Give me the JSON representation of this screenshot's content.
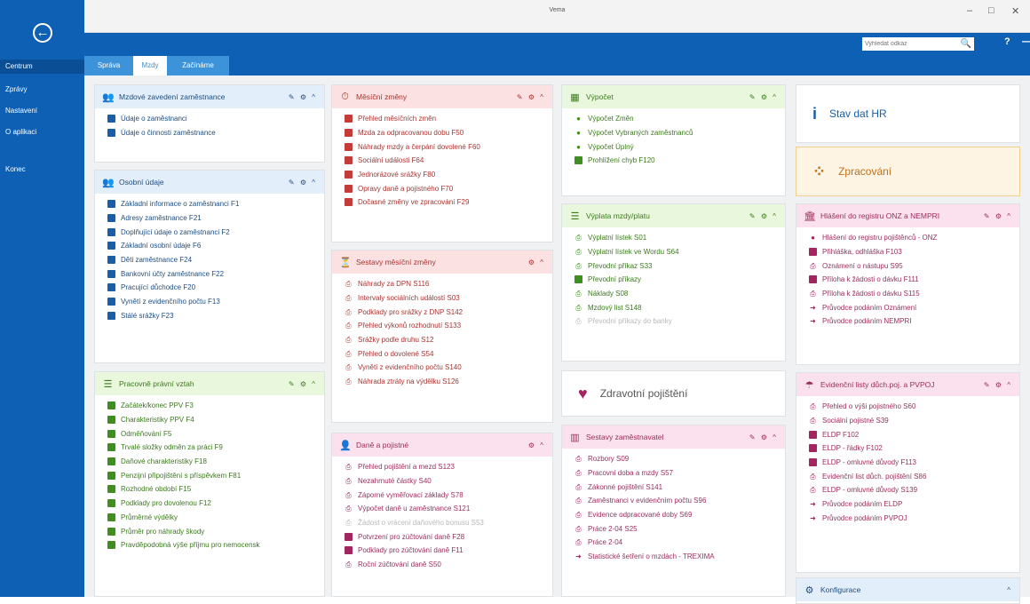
{
  "window": {
    "title": "Vema",
    "minimize": "–",
    "maximize": "□",
    "close": "✕"
  },
  "sidebar": {
    "back_icon": "←",
    "items": [
      {
        "label": "Centrum",
        "active": true
      },
      {
        "label": "Zprávy"
      },
      {
        "label": "Nastavení"
      },
      {
        "label": "O aplikaci"
      },
      {
        "label": "Konec"
      }
    ]
  },
  "topbar": {
    "search_placeholder": "Vyhledat odkaz",
    "search_icon": "🔍",
    "help": "?",
    "dash": "—"
  },
  "tabs": [
    {
      "label": "Správa"
    },
    {
      "label": "Mzdy",
      "active": true
    },
    {
      "label": "Začínáme"
    }
  ],
  "cards": {
    "mzdove": {
      "icon": "👥",
      "title": "Mzdové zavedení zaměstnance",
      "controls": "✎ ⚙ ^",
      "items": [
        "Údaje o zaměstnanci",
        "Údaje o činnosti zaměstnance"
      ]
    },
    "osobni": {
      "icon": "👥",
      "title": "Osobní údaje",
      "controls": "✎ ⚙ ^",
      "items": [
        "Základní informace o zaměstnanci F1",
        "Adresy zaměstnance F21",
        "Doplňující údaje o zaměstnanci F2",
        "Základní osobní údaje F6",
        "Děti zaměstnance F24",
        "Bankovní účty zaměstnance F22",
        "Pracující důchodce F20",
        "Vynětí z evidenčního počtu F13",
        "Stálé srážky F23"
      ]
    },
    "pracovne": {
      "icon": "☰",
      "title": "Pracovně právní vztah",
      "controls": "✎ ⚙ ^",
      "items": [
        "Začátek/konec PPV F3",
        "Charakteristiky PPV F4",
        "Odměňování F5",
        "Trvalé složky odměn za práci F9",
        "Daňové charakteristiky F18",
        "Penzijní připojištění s příspěvkem F81",
        "Rozhodné období F15",
        "Podklady pro dovolenou F12",
        "Průměrné výdělky",
        "Průměr pro náhrady škody",
        "Pravděpodobná výše příjmu pro nemocensk"
      ]
    },
    "mesicni": {
      "icon": "⏱",
      "title": "Měsíční změny",
      "controls": "✎ ⚙ ^",
      "items": [
        "Přehled měsíčních změn",
        "Mzda za odpracovanou dobu F50",
        "Náhrady mzdy a čerpání dovolené F60",
        "Sociální události F64",
        "Jednorázové srážky F80",
        "Opravy daně a pojistného F70",
        "Dočasné změny ve zpracování F29"
      ]
    },
    "sestavy_mesicni": {
      "icon": "⏳",
      "title": "Sestavy měsíční změny",
      "controls": "⚙ ^",
      "items": [
        "Náhrady za DPN S116",
        "Intervaly sociálních událostí S03",
        "Podklady pro srážky z DNP S142",
        "Přehled výkonů rozhodnutí S133",
        "Srážky podle druhu S12",
        "Přehled o dovolené S54",
        "Vynětí z evidenčního počtu S140",
        "Náhrada ztráty na výdělku S126"
      ]
    },
    "dane": {
      "icon": "👤",
      "title": "Daně a pojistné",
      "controls": "⚙ ^",
      "items": [
        {
          "label": "Přehled pojištění a mezd S123",
          "ic": "pr"
        },
        {
          "label": "Nezahrnuté částky S40",
          "ic": "pr"
        },
        {
          "label": "Záporné vyměřovací základy S78",
          "ic": "pr"
        },
        {
          "label": "Výpočet daně u zaměstnance S121",
          "ic": "pr"
        },
        {
          "label": "Žádost o vrácení daňového bonusu S53",
          "ic": "pr",
          "dis": true
        },
        {
          "label": "Potvrzení pro zúčtování daně F28",
          "ic": "sq"
        },
        {
          "label": "Podklady pro zúčtování daně F11",
          "ic": "sq"
        },
        {
          "label": "Roční zúčtování daně S50",
          "ic": "pr"
        }
      ]
    },
    "vypocet": {
      "icon": "▦",
      "title": "Výpočet",
      "controls": "✎ ⚙ ^",
      "items": [
        {
          "label": "Výpočet Změn",
          "ic": "dot"
        },
        {
          "label": "Výpočet Vybraných zaměstnanců",
          "ic": "dot"
        },
        {
          "label": "Výpočet Úplný",
          "ic": "dot"
        },
        {
          "label": "Prohlížení chyb F120",
          "ic": "sq"
        }
      ]
    },
    "vyplata": {
      "icon": "☰",
      "title": "Výplata mzdy/platu",
      "controls": "✎ ⚙ ^",
      "items": [
        {
          "label": "Výplatní lístek S01",
          "ic": "pr"
        },
        {
          "label": "Výplatní lístek ve Wordu S64",
          "ic": "pr"
        },
        {
          "label": "Převodní příkaz S33",
          "ic": "pr"
        },
        {
          "label": "Převodní příkazy",
          "ic": "sq"
        },
        {
          "label": "Náklady S08",
          "ic": "pr"
        },
        {
          "label": "Mzdový list S148",
          "ic": "pr"
        },
        {
          "label": "Převodní příkazy do banky",
          "ic": "pr",
          "dis": true
        }
      ]
    },
    "zdravotni": {
      "icon": "♥",
      "title": "Zdravotní pojištění"
    },
    "sestavy_zam": {
      "icon": "▥",
      "title": "Sestavy zaměstnavatel",
      "controls": "✎ ⚙ ^",
      "items": [
        {
          "label": "Rozbory S09",
          "ic": "pr"
        },
        {
          "label": "Pracovní doba a mzdy S57",
          "ic": "pr"
        },
        {
          "label": "Zákonné pojištění S141",
          "ic": "pr"
        },
        {
          "label": "Zaměstnanci v evidenčním počtu S96",
          "ic": "pr"
        },
        {
          "label": "Evidence odpracované doby S69",
          "ic": "pr"
        },
        {
          "label": "Práce 2-04 S25",
          "ic": "pr"
        },
        {
          "label": "Práce 2-04",
          "ic": "pr"
        },
        {
          "label": "Statistické šetření o mzdách - TREXIMA",
          "ic": "ar"
        }
      ]
    },
    "stav": {
      "icon": "i",
      "title": "Stav dat HR"
    },
    "zpracovani": {
      "icon": "⁘",
      "title": "Zpracování"
    },
    "hlaseni": {
      "icon": "🏛",
      "title": "Hlášení do registru ONZ a NEMPRI",
      "controls": "✎ ⚙ ^",
      "items": [
        {
          "label": "Hlášení do registru pojištěnců - ONZ",
          "ic": "dot"
        },
        {
          "label": "Přihláška, odhláška F103",
          "ic": "sq"
        },
        {
          "label": "Oznámení o nástupu S95",
          "ic": "pr"
        },
        {
          "label": "Příloha k žádosti o dávku F111",
          "ic": "sq"
        },
        {
          "label": "Příloha k žádosti o dávku S115",
          "ic": "pr"
        },
        {
          "label": "Průvodce podáním Oznámení",
          "ic": "ar"
        },
        {
          "label": "Průvodce podáním NEMPRI",
          "ic": "ar"
        }
      ]
    },
    "evidencni": {
      "icon": "☂",
      "title": "Evidenční listy důch.poj. a PVPOJ",
      "controls": "✎ ⚙ ^",
      "items": [
        {
          "label": "Přehled o výši pojistného S60",
          "ic": "pr"
        },
        {
          "label": "Sociální pojistné S39",
          "ic": "pr"
        },
        {
          "label": "ELDP F102",
          "ic": "sq"
        },
        {
          "label": "ELDP - řádky F102",
          "ic": "sq"
        },
        {
          "label": "ELDP - omluvné důvody F113",
          "ic": "sq"
        },
        {
          "label": "Evidenční list důch. pojištění S86",
          "ic": "pr"
        },
        {
          "label": "ELDP - omluvné důvody S139",
          "ic": "pr"
        },
        {
          "label": "Průvodce podáním ELDP",
          "ic": "ar"
        },
        {
          "label": "Průvodce podáním PVPOJ",
          "ic": "ar"
        }
      ]
    },
    "konfigurace": {
      "icon": "⚙",
      "title": "Konfigurace",
      "controls": "^"
    }
  }
}
